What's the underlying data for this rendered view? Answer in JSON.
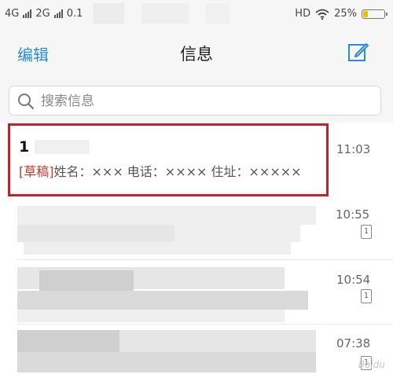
{
  "status_bar": {
    "network1": "4G",
    "network2": "2G",
    "carrier_partial": "0.1",
    "hd": "HD",
    "battery_percent": "25%",
    "battery_level": 0.25
  },
  "nav": {
    "edit_label": "编辑",
    "title": "信息",
    "compose_icon": "compose-icon"
  },
  "search": {
    "placeholder": "搜索信息"
  },
  "messages": [
    {
      "sender": "1",
      "draft_tag": "[草稿]",
      "preview": "姓名：××× 电话：×××× 住址：×××××",
      "time": "11:03",
      "highlighted": true
    },
    {
      "time": "10:55",
      "sim": "1"
    },
    {
      "time": "10:54",
      "sim": "1"
    },
    {
      "time": "07:38",
      "sim": "1"
    }
  ],
  "accent_color": "#2a8bd8",
  "highlight_color": "#c0232a"
}
